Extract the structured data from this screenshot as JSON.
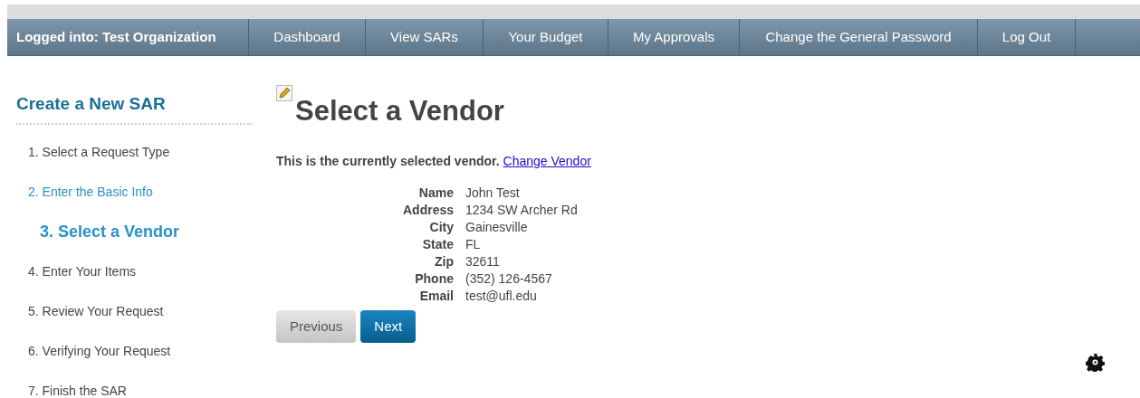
{
  "nav": {
    "login_label": "Logged into: Test Organization",
    "links": [
      "Dashboard",
      "View SARs",
      "Your Budget",
      "My Approvals",
      "Change the General Password",
      "Log Out"
    ]
  },
  "sidebar": {
    "title": "Create a New SAR",
    "steps": [
      {
        "label": "1. Select a Request Type",
        "kind": "plain"
      },
      {
        "label": "2. Enter the Basic Info",
        "kind": "link"
      },
      {
        "label": "3. Select a Vendor",
        "kind": "current"
      },
      {
        "label": "4. Enter Your Items",
        "kind": "plain"
      },
      {
        "label": "5. Review Your Request",
        "kind": "plain"
      },
      {
        "label": "6. Verifying Your Request",
        "kind": "plain"
      },
      {
        "label": "7. Finish the SAR",
        "kind": "plain"
      }
    ]
  },
  "main": {
    "title": "Select a Vendor",
    "notice": "This is the currently selected vendor.",
    "change_link": "Change Vendor",
    "vendor": [
      {
        "label": "Name",
        "value": "John Test"
      },
      {
        "label": "Address",
        "value": "1234 SW Archer Rd"
      },
      {
        "label": "City",
        "value": "Gainesville"
      },
      {
        "label": "State",
        "value": "FL"
      },
      {
        "label": "Zip",
        "value": "32611"
      },
      {
        "label": "Phone",
        "value": "(352) 126-4567"
      },
      {
        "label": "Email",
        "value": "test@ufl.edu"
      }
    ],
    "buttons": [
      {
        "label": "Previous",
        "kind": "secondary"
      },
      {
        "label": "Next",
        "kind": "primary"
      }
    ]
  }
}
